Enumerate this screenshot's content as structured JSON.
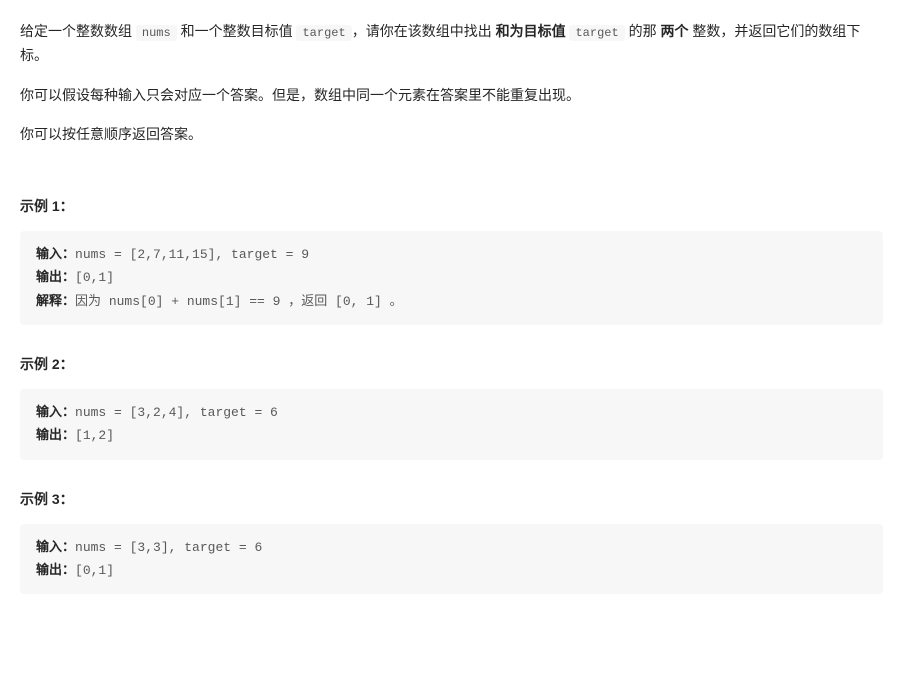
{
  "intro": {
    "p1_part1": "给定一个整数数组 ",
    "p1_code1": "nums",
    "p1_part2": " 和一个整数目标值 ",
    "p1_code2": "target",
    "p1_part3": "，请你在该数组中找出 ",
    "p1_bold1": "和为目标值",
    "p1_part4": " ",
    "p1_code3": "target",
    "p1_part5": "  的那 ",
    "p1_bold2": "两个",
    "p1_part6": " 整数，并返回它们的数组下标。",
    "p2": "你可以假设每种输入只会对应一个答案。但是，数组中同一个元素在答案里不能重复出现。",
    "p3": "你可以按任意顺序返回答案。"
  },
  "examples": [
    {
      "heading": "示例 1：",
      "labels": {
        "input": "输入：",
        "output": "输出：",
        "explain": "解释："
      },
      "input": "nums = [2,7,11,15], target = 9",
      "output": "[0,1]",
      "explain": "因为 nums[0] + nums[1] == 9 ，返回 [0, 1] 。"
    },
    {
      "heading": "示例 2：",
      "labels": {
        "input": "输入：",
        "output": "输出："
      },
      "input": "nums = [3,2,4], target = 6",
      "output": "[1,2]"
    },
    {
      "heading": "示例 3：",
      "labels": {
        "input": "输入：",
        "output": "输出："
      },
      "input": "nums = [3,3], target = 6",
      "output": "[0,1]"
    }
  ]
}
